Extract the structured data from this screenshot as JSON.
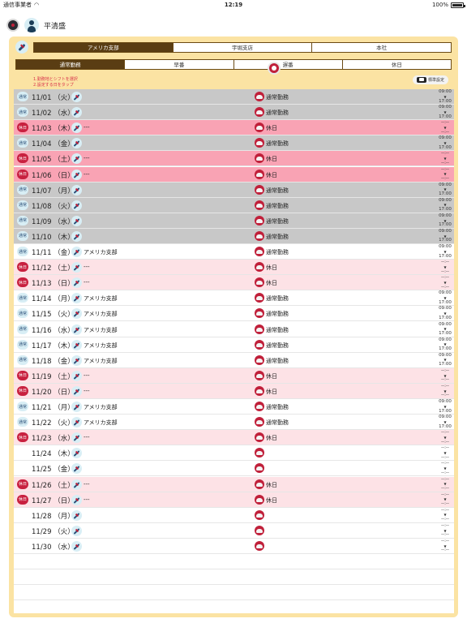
{
  "status_bar": {
    "carrier": "通信事業者",
    "time": "12:19",
    "device": "iPad",
    "battery": "100%"
  },
  "header": {
    "user_name": "平清盛"
  },
  "branch_tabs": [
    {
      "label": "アメリカ支部",
      "active": true
    },
    {
      "label": "宇堀支店",
      "active": false
    },
    {
      "label": "本社",
      "active": false
    }
  ],
  "shift_tabs": [
    {
      "label": "通常勤務",
      "active": true
    },
    {
      "label": "早番",
      "active": false
    },
    {
      "label": "遅番",
      "active": false
    },
    {
      "label": "休日",
      "active": false
    }
  ],
  "instructions": [
    "1.勤務地とシフトを選択",
    "2.設定する日をタップ"
  ],
  "standard_button": {
    "label": "標準設定"
  },
  "colors": {
    "panel": "#fbe3a3",
    "gray_row": "#c8c8c8",
    "pink_row": "#f9a3b4",
    "light_pink_row": "#fde2e6",
    "active_tab": "#5a3d13",
    "holiday_badge": "#c8203f"
  },
  "rows": [
    {
      "badge": "通常",
      "date": "11/01 （火）",
      "place": "",
      "shift": "通常勤務",
      "time_start": "09:00",
      "time_end": "17:00",
      "tone": "gray"
    },
    {
      "badge": "通常",
      "date": "11/02 （水）",
      "place": "",
      "shift": "通常勤務",
      "time_start": "09:00",
      "time_end": "17:00",
      "tone": "gray"
    },
    {
      "badge": "休日",
      "date": "11/03 （木）",
      "place": "---",
      "shift": "休日",
      "time_start": "--:--",
      "time_end": "--:--",
      "tone": "pink"
    },
    {
      "badge": "通常",
      "date": "11/04 （金）",
      "place": "",
      "shift": "通常勤務",
      "time_start": "09:00",
      "time_end": "17:00",
      "tone": "gray"
    },
    {
      "badge": "休日",
      "date": "11/05 （土）",
      "place": "---",
      "shift": "休日",
      "time_start": "--:--",
      "time_end": "--:--",
      "tone": "pink"
    },
    {
      "badge": "休日",
      "date": "11/06 （日）",
      "place": "---",
      "shift": "休日",
      "time_start": "--:--",
      "time_end": "--:--",
      "tone": "pink"
    },
    {
      "badge": "通常",
      "date": "11/07 （月）",
      "place": "",
      "shift": "通常勤務",
      "time_start": "09:00",
      "time_end": "17:00",
      "tone": "gray"
    },
    {
      "badge": "通常",
      "date": "11/08 （火）",
      "place": "",
      "shift": "通常勤務",
      "time_start": "09:00",
      "time_end": "17:00",
      "tone": "gray"
    },
    {
      "badge": "通常",
      "date": "11/09 （水）",
      "place": "",
      "shift": "通常勤務",
      "time_start": "09:00",
      "time_end": "17:00",
      "tone": "gray"
    },
    {
      "badge": "通常",
      "date": "11/10 （木）",
      "place": "",
      "shift": "通常勤務",
      "time_start": "09:00",
      "time_end": "17:00",
      "tone": "gray"
    },
    {
      "badge": "通常",
      "date": "11/11 （金）",
      "place": "アメリカ支部",
      "shift": "通常勤務",
      "time_start": "09:00",
      "time_end": "17:00",
      "tone": "white"
    },
    {
      "badge": "休日",
      "date": "11/12 （土）",
      "place": "---",
      "shift": "休日",
      "time_start": "--:--",
      "time_end": "--:--",
      "tone": "lightpink"
    },
    {
      "badge": "休日",
      "date": "11/13 （日）",
      "place": "---",
      "shift": "休日",
      "time_start": "--:--",
      "time_end": "--:--",
      "tone": "lightpink"
    },
    {
      "badge": "通常",
      "date": "11/14 （月）",
      "place": "アメリカ支部",
      "shift": "通常勤務",
      "time_start": "09:00",
      "time_end": "17:00",
      "tone": "white"
    },
    {
      "badge": "通常",
      "date": "11/15 （火）",
      "place": "アメリカ支部",
      "shift": "通常勤務",
      "time_start": "09:00",
      "time_end": "17:00",
      "tone": "white"
    },
    {
      "badge": "通常",
      "date": "11/16 （水）",
      "place": "アメリカ支部",
      "shift": "通常勤務",
      "time_start": "09:00",
      "time_end": "17:00",
      "tone": "white"
    },
    {
      "badge": "通常",
      "date": "11/17 （木）",
      "place": "アメリカ支部",
      "shift": "通常勤務",
      "time_start": "09:00",
      "time_end": "17:00",
      "tone": "white"
    },
    {
      "badge": "通常",
      "date": "11/18 （金）",
      "place": "アメリカ支部",
      "shift": "通常勤務",
      "time_start": "09:00",
      "time_end": "17:00",
      "tone": "white"
    },
    {
      "badge": "休日",
      "date": "11/19 （土）",
      "place": "---",
      "shift": "休日",
      "time_start": "--:--",
      "time_end": "--:--",
      "tone": "lightpink"
    },
    {
      "badge": "休日",
      "date": "11/20 （日）",
      "place": "---",
      "shift": "休日",
      "time_start": "--:--",
      "time_end": "--:--",
      "tone": "lightpink"
    },
    {
      "badge": "通常",
      "date": "11/21 （月）",
      "place": "アメリカ支部",
      "shift": "通常勤務",
      "time_start": "09:00",
      "time_end": "17:00",
      "tone": "white"
    },
    {
      "badge": "通常",
      "date": "11/22 （火）",
      "place": "アメリカ支部",
      "shift": "通常勤務",
      "time_start": "09:00",
      "time_end": "17:00",
      "tone": "white"
    },
    {
      "badge": "休日",
      "date": "11/23 （水）",
      "place": "---",
      "shift": "休日",
      "time_start": "--:--",
      "time_end": "--:--",
      "tone": "lightpink"
    },
    {
      "badge": "",
      "date": "11/24 （木）",
      "place": "",
      "shift": "",
      "time_start": "--:--",
      "time_end": "--:--",
      "tone": "white"
    },
    {
      "badge": "",
      "date": "11/25 （金）",
      "place": "",
      "shift": "",
      "time_start": "--:--",
      "time_end": "--:--",
      "tone": "white"
    },
    {
      "badge": "休日",
      "date": "11/26 （土）",
      "place": "---",
      "shift": "休日",
      "time_start": "--:--",
      "time_end": "--:--",
      "tone": "lightpink"
    },
    {
      "badge": "休日",
      "date": "11/27 （日）",
      "place": "---",
      "shift": "休日",
      "time_start": "--:--",
      "time_end": "--:--",
      "tone": "lightpink"
    },
    {
      "badge": "",
      "date": "11/28 （月）",
      "place": "",
      "shift": "",
      "time_start": "--:--",
      "time_end": "--:--",
      "tone": "white"
    },
    {
      "badge": "",
      "date": "11/29 （火）",
      "place": "",
      "shift": "",
      "time_start": "--:--",
      "time_end": "--:--",
      "tone": "white"
    },
    {
      "badge": "",
      "date": "11/30 （水）",
      "place": "",
      "shift": "",
      "time_start": "--:--",
      "time_end": "--:--",
      "tone": "white"
    }
  ]
}
